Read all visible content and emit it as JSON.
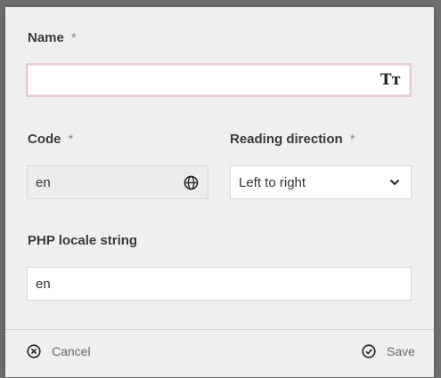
{
  "name": {
    "label": "Name",
    "required_marker": "*",
    "value": "",
    "icon": "text-format-icon",
    "icon_glyph": "Tт"
  },
  "code": {
    "label": "Code",
    "required_marker": "*",
    "value": "en",
    "icon": "globe-icon"
  },
  "reading_direction": {
    "label": "Reading direction",
    "required_marker": "*",
    "selected": "Left to right",
    "icon": "chevron-down-icon"
  },
  "php_locale": {
    "label": "PHP locale string",
    "value": "en"
  },
  "footer": {
    "cancel_label": "Cancel",
    "cancel_icon": "close-circle-icon",
    "save_label": "Save",
    "save_icon": "check-circle-icon"
  }
}
